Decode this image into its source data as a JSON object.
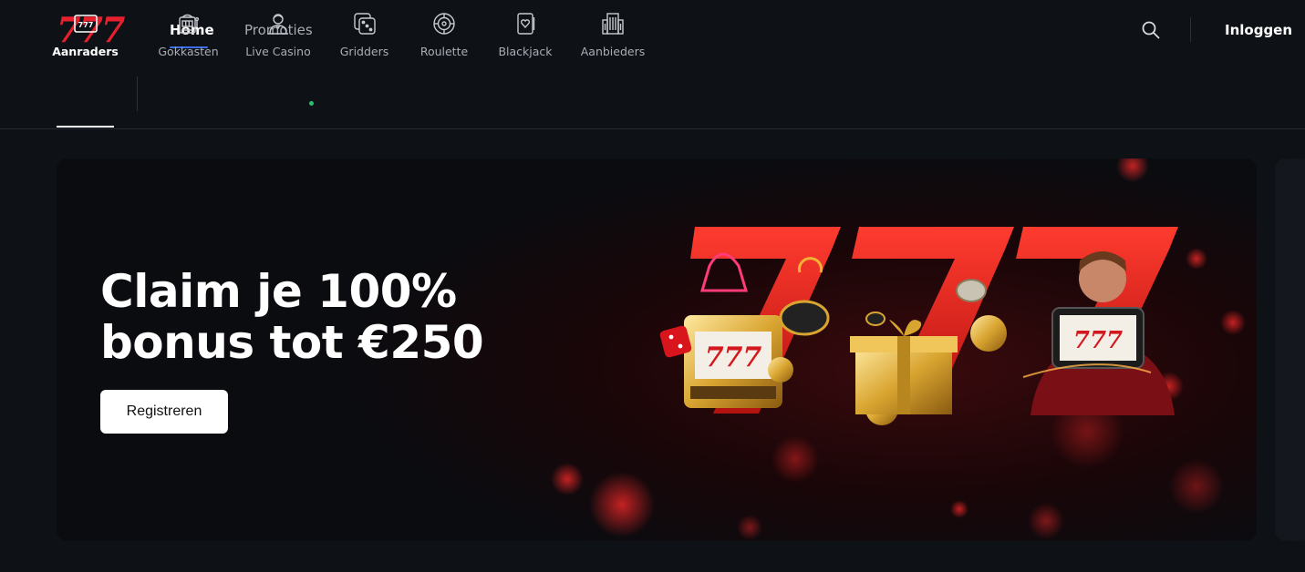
{
  "header": {
    "logo": "777",
    "nav": [
      {
        "label": "Home",
        "active": true
      },
      {
        "label": "Promoties",
        "active": false
      }
    ],
    "login_label": "Inloggen",
    "search_icon": "search-icon"
  },
  "categories": [
    {
      "label": "Aanraders",
      "icon": "777-badge-icon",
      "active": true
    },
    {
      "label": "Gokkasten",
      "icon": "slot-machine-icon",
      "active": false
    },
    {
      "label": "Live Casino",
      "icon": "dealer-icon",
      "active": false,
      "live": true
    },
    {
      "label": "Gridders",
      "icon": "dice-icon",
      "active": false
    },
    {
      "label": "Roulette",
      "icon": "roulette-icon",
      "active": false
    },
    {
      "label": "Blackjack",
      "icon": "playing-card-icon",
      "active": false
    },
    {
      "label": "Aanbieders",
      "icon": "building-icon",
      "active": false
    }
  ],
  "banner": {
    "headline_line1": "Claim je 100%",
    "headline_line2": "bonus tot €250",
    "cta_label": "Registreren",
    "reel_symbols": "777",
    "tablet_symbols": "777"
  },
  "colors": {
    "background": "#0e1116",
    "brand_red": "#e8202e",
    "nav_active_underline": "#3c6ff0",
    "live_dot": "#26c06a"
  }
}
